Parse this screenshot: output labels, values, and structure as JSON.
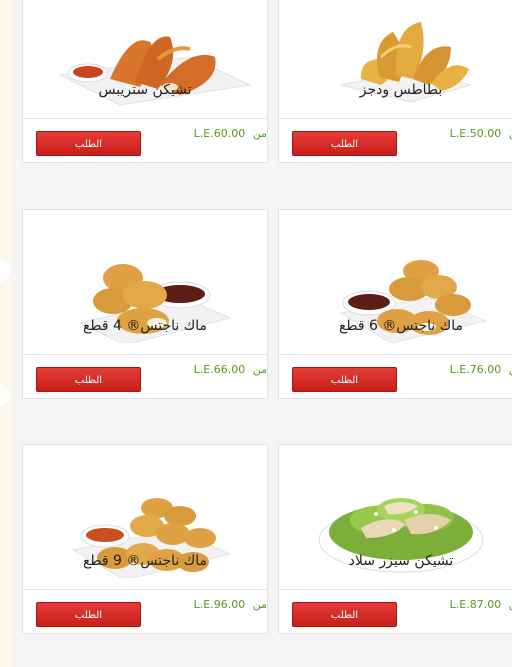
{
  "order_label": "الطلب",
  "price_prefix": "من",
  "products": [
    {
      "name": "تشيكن ستريبس",
      "price": "L.E.60.00",
      "image": "chicken-strips-icon"
    },
    {
      "name": "بطاطس ودجز",
      "price": "L.E.50.00",
      "image": "potato-wedges-icon"
    },
    {
      "name": "ماك ناجتس® 4 قطع",
      "price": "L.E.66.00",
      "image": "nuggets-4-icon"
    },
    {
      "name": "ماك ناجتس® 6 قطع",
      "price": "L.E.76.00",
      "image": "nuggets-6-icon"
    },
    {
      "name": "ماك ناجتس® 9 قطع",
      "price": "L.E.96.00",
      "image": "nuggets-9-icon"
    },
    {
      "name": "تشيكن سيزر سلاد",
      "price": "L.E.87.00",
      "image": "caesar-salad-icon"
    }
  ],
  "colors": {
    "button": "#d62b26",
    "price": "#5a9a1c"
  }
}
